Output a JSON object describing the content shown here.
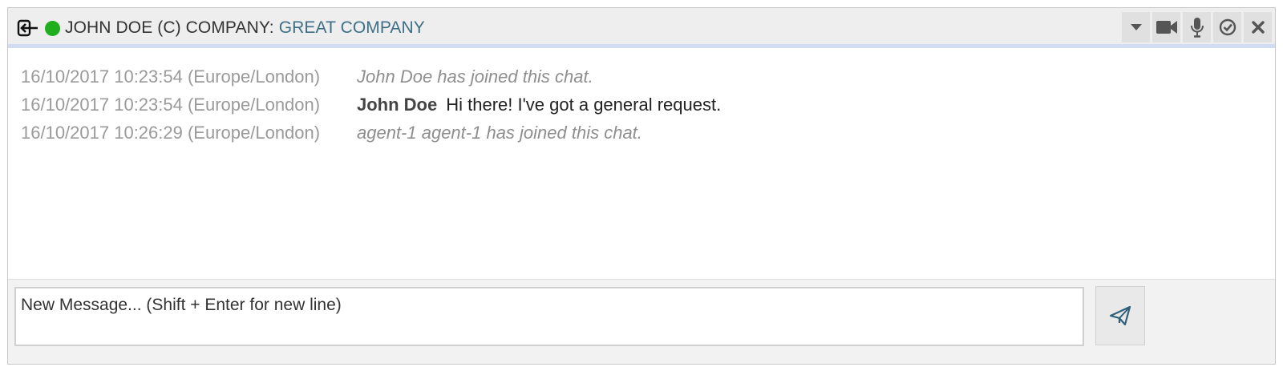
{
  "header": {
    "contact_label": "JOHN DOE (C) COMPANY:",
    "company_link": "GREAT COMPANY",
    "status_color": "#1eae1e",
    "icons": [
      "exit-icon",
      "chevron-down-icon",
      "video-camera-icon",
      "microphone-icon",
      "check-circle-icon",
      "close-icon"
    ]
  },
  "messages": [
    {
      "time": "16/10/2017 10:23:54 (Europe/London)",
      "system_text": "John Doe has joined this chat."
    },
    {
      "time": "16/10/2017 10:23:54 (Europe/London)",
      "author": "John Doe",
      "text": "Hi there! I've got a general request."
    },
    {
      "time": "16/10/2017 10:26:29 (Europe/London)",
      "system_text": "agent-1 agent-1 has joined this chat."
    }
  ],
  "composer": {
    "placeholder": "New Message... (Shift + Enter for new line)",
    "send_icon": "paper-plane-icon"
  },
  "colors": {
    "header_bg": "#eeeeee",
    "header_underline": "#d2dcf3",
    "link": "#3d6e85",
    "timestamp": "#9a9a9a"
  }
}
